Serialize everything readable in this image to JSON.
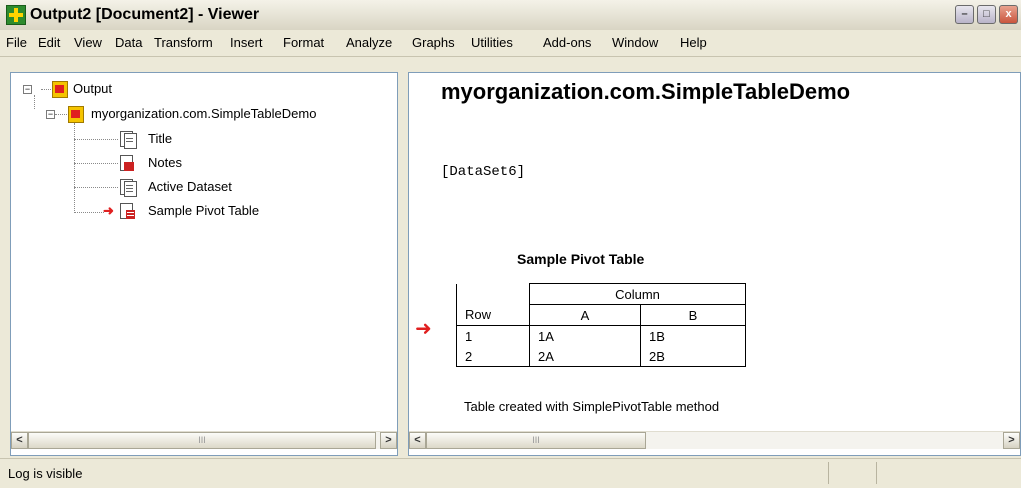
{
  "window": {
    "title": "Output2 [Document2] - Viewer",
    "icon": "viewer-app-icon",
    "controls": {
      "minimize": "–",
      "maximize": "□",
      "close": "x"
    }
  },
  "menu": [
    "File",
    "Edit",
    "View",
    "Data",
    "Transform",
    "Insert",
    "Format",
    "Analyze",
    "Graphs",
    "Utilities",
    "Add-ons",
    "Window",
    "Help"
  ],
  "tree": {
    "root": {
      "label": "Output",
      "expander": "−"
    },
    "child": {
      "label": "myorganization.com.SimpleTableDemo",
      "expander": "−"
    },
    "items": [
      {
        "label": "Title",
        "icon": "title-doc-icon"
      },
      {
        "label": "Notes",
        "icon": "notes-doc-icon"
      },
      {
        "label": "Active Dataset",
        "icon": "log-doc-icon"
      },
      {
        "label": "Sample Pivot Table",
        "icon": "pivot-table-icon",
        "selected_arrow": true
      }
    ]
  },
  "content": {
    "heading": "myorganization.com.SimpleTableDemo",
    "dataset": "[DataSet6]",
    "pivot": {
      "title": "Sample Pivot Table",
      "column_header": "Column",
      "row_header": "Row",
      "columns": [
        "A",
        "B"
      ],
      "rows": [
        {
          "label": "1",
          "cells": [
            "1A",
            "1B"
          ]
        },
        {
          "label": "2",
          "cells": [
            "2A",
            "2B"
          ]
        }
      ],
      "caption": "Table created with SimplePivotTable method"
    }
  },
  "scrollbars": {
    "left_arrow": "<",
    "right_arrow": ">",
    "thumb_grip": "III"
  },
  "status": {
    "text": "Log is visible"
  },
  "colors": {
    "accent_red": "#e02020",
    "pane_border": "#7f9db9",
    "chrome": "#ece9d8"
  }
}
